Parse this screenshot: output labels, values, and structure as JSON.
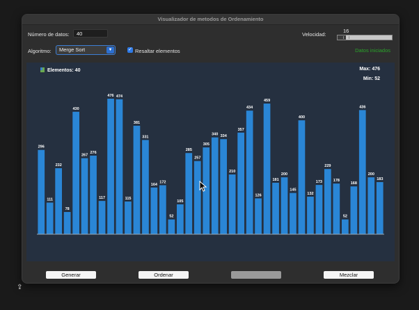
{
  "window": {
    "title": "Visualizador de metodos de Ordenamiento"
  },
  "controls": {
    "num_label": "Número de datos:",
    "num_value": "40",
    "speed_label": "Velocidad:",
    "speed_value": "16",
    "speed_fraction": 0.16,
    "algo_label": "Algoritmo:",
    "algo_value": "Merge Sort",
    "highlight_label": "Resaltar elementos",
    "highlight_checked": true,
    "status": "Datos iniciados"
  },
  "buttons": {
    "generate": "Generar",
    "sort": "Ordenar",
    "disabled": "",
    "shuffle": "Mezclar"
  },
  "colors": {
    "bar": "#2a86d6",
    "status": "#2aa52a",
    "panel": "#253040"
  },
  "chart_data": {
    "type": "bar",
    "elements_label": "Elementos: 40",
    "max_label": "Max: 476",
    "min_label": "Min: 52",
    "values": [
      296,
      111,
      232,
      78,
      430,
      267,
      276,
      117,
      476,
      474,
      115,
      381,
      331,
      164,
      172,
      52,
      105,
      285,
      257,
      305,
      340,
      334,
      210,
      357,
      434,
      126,
      459,
      181,
      200,
      145,
      400,
      132,
      173,
      229,
      178,
      52,
      168,
      436,
      200,
      183
    ],
    "ylim": [
      0,
      476
    ]
  }
}
